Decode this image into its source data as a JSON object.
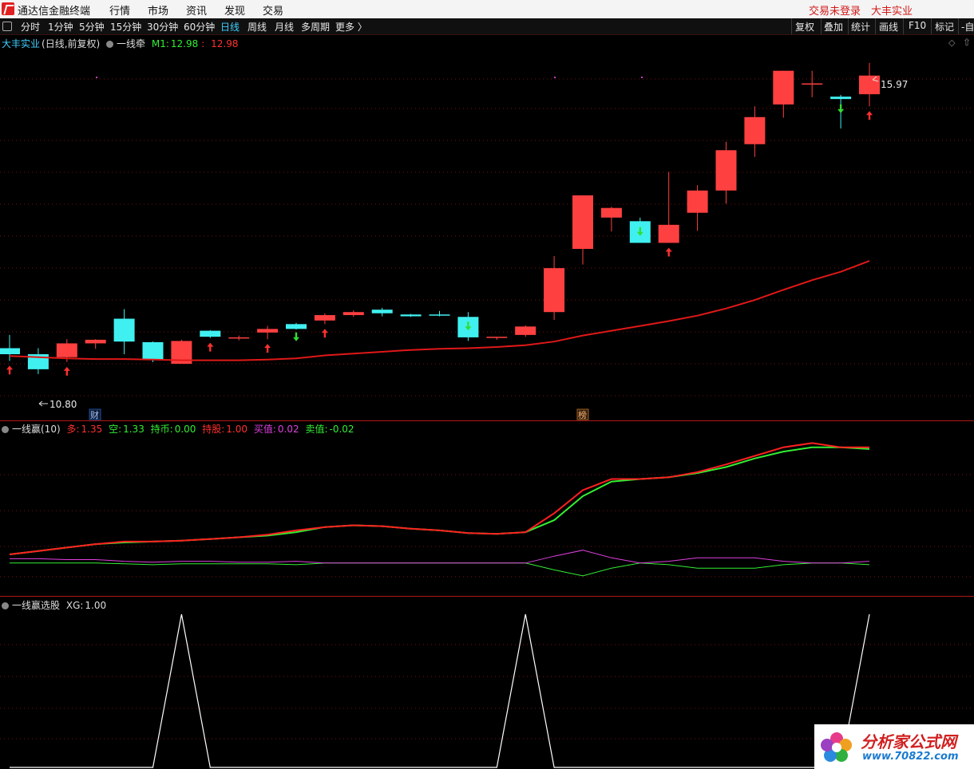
{
  "app": {
    "title": "通达信金融终端",
    "menu": [
      "行情",
      "市场",
      "资讯",
      "发现",
      "交易"
    ],
    "login_status": "交易未登录",
    "stock_name": "大丰实业"
  },
  "toolbar": {
    "periods": [
      "分时",
      "1分钟",
      "5分钟",
      "15分钟",
      "30分钟",
      "60分钟",
      "日线",
      "周线",
      "月线",
      "多周期",
      "更多 〉"
    ],
    "active_period": "日线",
    "right_buttons": [
      "复权",
      "叠加",
      "统计",
      "画线",
      "F10",
      "标记",
      "-自"
    ]
  },
  "main_panel": {
    "stock": "大丰实业",
    "mode": "(日线,前复权)",
    "indicator": "一线牵",
    "m1_label": "M1:",
    "m1_green": "12.98",
    "m1_red": "12.98",
    "high_label": "15.97",
    "low_label": "10.80",
    "marker_cai": "财",
    "marker_bang": "榜"
  },
  "sub1": {
    "name": "一线赢(10)",
    "fields": [
      {
        "label": "多:",
        "value": "1.35",
        "color": "#ff3030"
      },
      {
        "label": "空:",
        "value": "1.33",
        "color": "#33ee33"
      },
      {
        "label": "持币:",
        "value": "0.00",
        "color": "#33ee33"
      },
      {
        "label": "持股:",
        "value": "1.00",
        "color": "#ff3030"
      },
      {
        "label": "买值:",
        "value": "0.02",
        "color": "#e040e0"
      },
      {
        "label": "卖值:",
        "value": "-0.02",
        "color": "#33ee33"
      }
    ]
  },
  "sub2": {
    "name": "一线赢选股",
    "xg_label": "XG:",
    "xg_value": "1.00"
  },
  "watermark": {
    "site_name": "分析家公式网",
    "site_url": "www.70822.com"
  },
  "chart_data": [
    {
      "type": "candlestick",
      "title": "大丰实业 (日线,前复权)",
      "candles": [
        {
          "open": 11.23,
          "high": 11.45,
          "low": 11.02,
          "close": 11.13
        },
        {
          "open": 11.13,
          "high": 11.23,
          "low": 10.8,
          "close": 10.88
        },
        {
          "open": 11.08,
          "high": 11.38,
          "low": 11.0,
          "close": 11.31
        },
        {
          "open": 11.31,
          "high": 11.38,
          "low": 11.22,
          "close": 11.37
        },
        {
          "open": 11.72,
          "high": 11.88,
          "low": 11.13,
          "close": 11.34
        },
        {
          "open": 11.33,
          "high": 11.34,
          "low": 11.0,
          "close": 11.04
        },
        {
          "open": 10.97,
          "high": 11.37,
          "low": 10.97,
          "close": 11.35
        },
        {
          "open": 11.52,
          "high": 11.53,
          "low": 11.4,
          "close": 11.42
        },
        {
          "open": 11.41,
          "high": 11.44,
          "low": 11.36,
          "close": 11.41
        },
        {
          "open": 11.49,
          "high": 11.6,
          "low": 11.38,
          "close": 11.55
        },
        {
          "open": 11.63,
          "high": 11.65,
          "low": 11.54,
          "close": 11.55
        },
        {
          "open": 11.69,
          "high": 11.81,
          "low": 11.63,
          "close": 11.78
        },
        {
          "open": 11.78,
          "high": 11.86,
          "low": 11.75,
          "close": 11.83
        },
        {
          "open": 11.87,
          "high": 11.9,
          "low": 11.76,
          "close": 11.81
        },
        {
          "open": 11.79,
          "high": 11.8,
          "low": 11.75,
          "close": 11.76
        },
        {
          "open": 11.79,
          "high": 11.85,
          "low": 11.76,
          "close": 11.78
        },
        {
          "open": 11.75,
          "high": 11.83,
          "low": 11.35,
          "close": 11.41
        },
        {
          "open": 11.4,
          "high": 11.41,
          "low": 11.37,
          "close": 11.42
        },
        {
          "open": 11.45,
          "high": 11.61,
          "low": 11.42,
          "close": 11.59
        },
        {
          "open": 11.83,
          "high": 12.76,
          "low": 11.7,
          "close": 12.56
        },
        {
          "open": 12.88,
          "high": 13.77,
          "low": 12.62,
          "close": 13.77
        },
        {
          "open": 13.4,
          "high": 13.58,
          "low": 13.17,
          "close": 13.56
        },
        {
          "open": 13.34,
          "high": 13.4,
          "low": 12.98,
          "close": 12.98
        },
        {
          "open": 12.98,
          "high": 14.16,
          "low": 12.98,
          "close": 13.28
        },
        {
          "open": 13.48,
          "high": 13.94,
          "low": 13.18,
          "close": 13.85
        },
        {
          "open": 13.85,
          "high": 14.66,
          "low": 13.63,
          "close": 14.52
        },
        {
          "open": 14.62,
          "high": 15.25,
          "low": 14.41,
          "close": 15.07
        },
        {
          "open": 15.28,
          "high": 15.84,
          "low": 15.06,
          "close": 15.84
        },
        {
          "open": 15.63,
          "high": 15.84,
          "low": 15.4,
          "close": 15.63
        },
        {
          "open": 15.41,
          "high": 15.44,
          "low": 14.88,
          "close": 15.37
        },
        {
          "open": 15.45,
          "high": 15.97,
          "low": 15.25,
          "close": 15.76
        }
      ],
      "ma_series": {
        "name": "M1",
        "values": [
          11.1,
          11.08,
          11.06,
          11.05,
          11.05,
          11.04,
          11.03,
          11.03,
          11.03,
          11.04,
          11.06,
          11.11,
          11.14,
          11.17,
          11.2,
          11.22,
          11.23,
          11.25,
          11.28,
          11.34,
          11.44,
          11.52,
          11.6,
          11.68,
          11.77,
          11.89,
          12.03,
          12.2,
          12.36,
          12.5,
          12.68
        ]
      },
      "up_arrow_days": [
        0,
        2,
        7,
        9,
        11,
        23,
        30
      ],
      "down_arrow_days": [
        10,
        16,
        22,
        29
      ],
      "y_range": [
        10.6,
        16.3
      ]
    },
    {
      "type": "line",
      "title": "一线赢(10)",
      "series": [
        {
          "name": "多",
          "color": "#ff2020",
          "values": [
            0.1,
            0.14,
            0.18,
            0.22,
            0.25,
            0.25,
            0.26,
            0.28,
            0.3,
            0.33,
            0.38,
            0.42,
            0.44,
            0.43,
            0.4,
            0.38,
            0.35,
            0.34,
            0.36,
            0.58,
            0.85,
            0.98,
            0.98,
            1.0,
            1.06,
            1.15,
            1.25,
            1.35,
            1.4,
            1.35,
            1.35
          ]
        },
        {
          "name": "空",
          "color": "#33ee33",
          "values": [
            0.1,
            0.14,
            0.18,
            0.22,
            0.24,
            0.25,
            0.26,
            0.28,
            0.3,
            0.32,
            0.36,
            0.42,
            0.44,
            0.43,
            0.4,
            0.38,
            0.35,
            0.34,
            0.36,
            0.5,
            0.78,
            0.95,
            0.98,
            1.0,
            1.05,
            1.12,
            1.22,
            1.3,
            1.35,
            1.35,
            1.33
          ]
        },
        {
          "name": "买值",
          "color": "#e040e0",
          "values": [
            0.05,
            0.05,
            0.04,
            0.04,
            0.02,
            0.01,
            0.02,
            0.02,
            0.01,
            0.01,
            0.02,
            0.0,
            0.0,
            0.0,
            0.0,
            0.0,
            0.0,
            0.0,
            0.0,
            0.08,
            0.15,
            0.06,
            0.0,
            0.02,
            0.06,
            0.06,
            0.06,
            0.02,
            0.0,
            0.0,
            0.02
          ]
        },
        {
          "name": "卖值",
          "color": "#33ee33",
          "values": [
            0.0,
            0.0,
            0.0,
            0.0,
            -0.01,
            -0.02,
            -0.01,
            -0.01,
            -0.01,
            -0.01,
            -0.02,
            0.0,
            0.0,
            0.0,
            0.0,
            0.0,
            0.0,
            0.0,
            0.0,
            -0.08,
            -0.15,
            -0.06,
            0.0,
            -0.02,
            -0.06,
            -0.06,
            -0.06,
            -0.02,
            0.0,
            0.0,
            -0.02
          ]
        }
      ],
      "y_range": [
        -0.3,
        1.45
      ]
    },
    {
      "type": "line",
      "title": "一线赢选股",
      "series": [
        {
          "name": "XG",
          "color": "#ffffff",
          "values": [
            0,
            0,
            0,
            0,
            0,
            0,
            1,
            0,
            0,
            0,
            0,
            0,
            0,
            0,
            0,
            0,
            0,
            0,
            1,
            0,
            0,
            0,
            0,
            0,
            0,
            0,
            0,
            0,
            0,
            0,
            1
          ]
        }
      ],
      "y_range": [
        0,
        1.0
      ]
    }
  ]
}
